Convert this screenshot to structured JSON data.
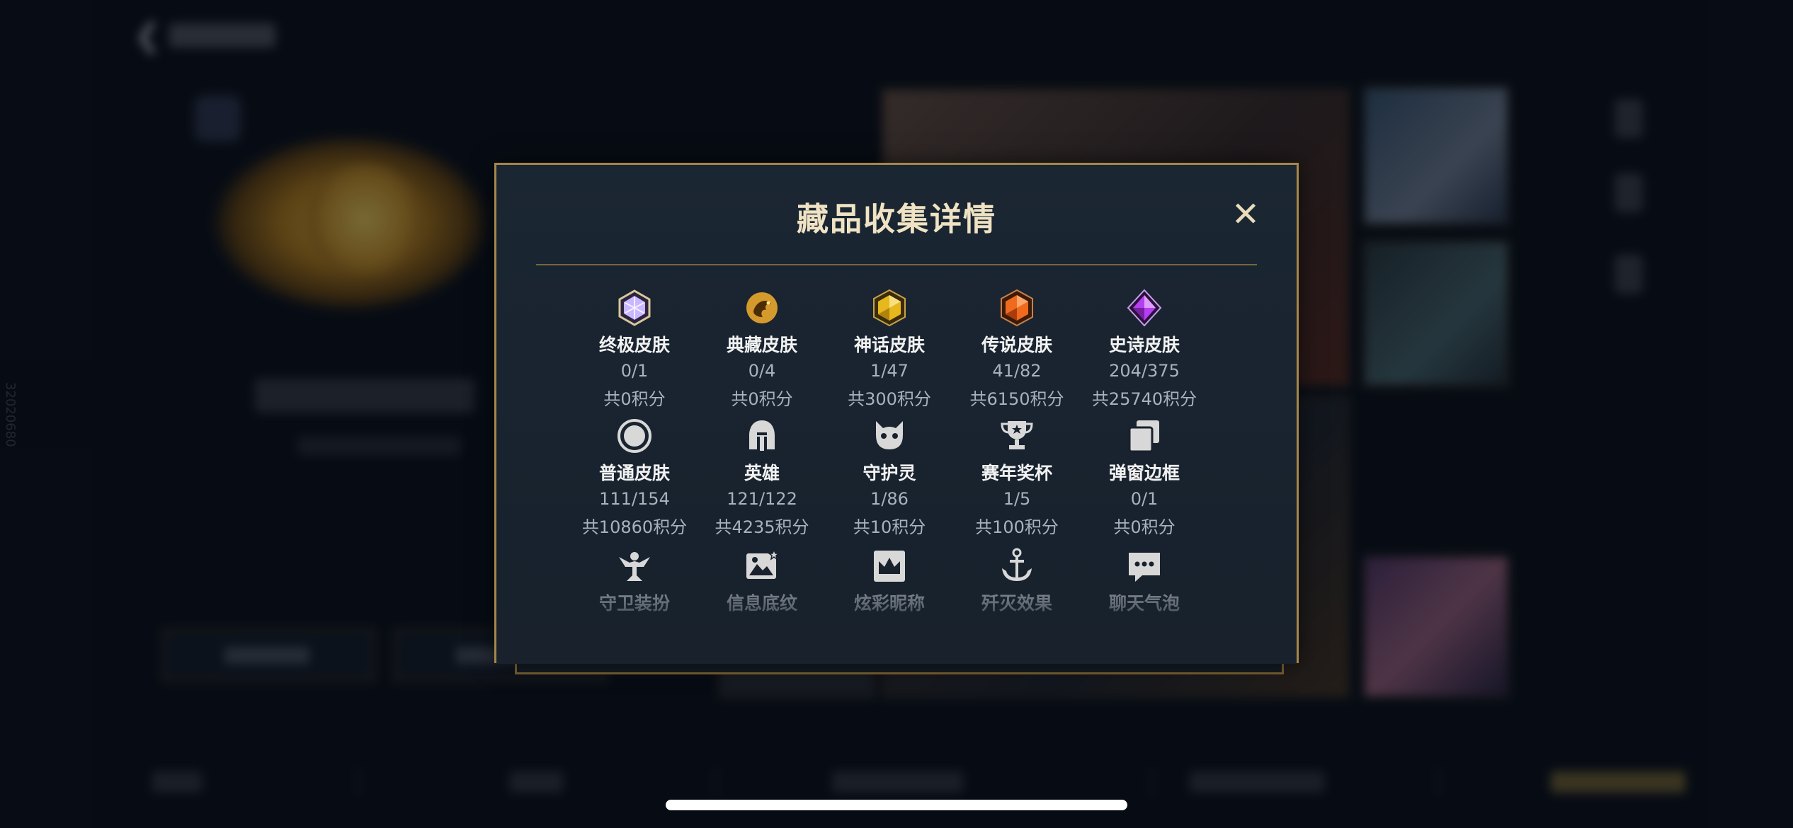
{
  "modal": {
    "title": "藏品收集详情",
    "close_glyph": "✕"
  },
  "collection": [
    {
      "name": "终极皮肤",
      "count": "0/1",
      "points": "共0积分",
      "icon": "ultimate-gem-icon",
      "color": "#c9b8ff"
    },
    {
      "name": "典藏皮肤",
      "count": "0/4",
      "points": "共0积分",
      "icon": "prestige-dragon-icon",
      "color": "#d59a2c"
    },
    {
      "name": "神话皮肤",
      "count": "1/47",
      "points": "共300积分",
      "icon": "mythic-gem-icon",
      "color": "#e6b81e"
    },
    {
      "name": "传说皮肤",
      "count": "41/82",
      "points": "共6150积分",
      "icon": "legendary-gem-icon",
      "color": "#f06a1e"
    },
    {
      "name": "史诗皮肤",
      "count": "204/375",
      "points": "共25740积分",
      "icon": "epic-gem-icon",
      "color": "#b43ef0"
    },
    {
      "name": "普通皮肤",
      "count": "111/154",
      "points": "共10860积分",
      "icon": "ring-icon",
      "color": "#d8d8d8"
    },
    {
      "name": "英雄",
      "count": "121/122",
      "points": "共4235积分",
      "icon": "helmet-icon",
      "color": "#d8d8d8"
    },
    {
      "name": "守护灵",
      "count": "1/86",
      "points": "共10积分",
      "icon": "little-legend-icon",
      "color": "#d8d8d8"
    },
    {
      "name": "赛年奖杯",
      "count": "1/5",
      "points": "共100积分",
      "icon": "trophy-icon",
      "color": "#d8d8d8"
    },
    {
      "name": "弹窗边框",
      "count": "0/1",
      "points": "共0积分",
      "icon": "frames-icon",
      "color": "#d8d8d8"
    },
    {
      "name": "守卫装扮",
      "icon": "ward-icon",
      "color": "#d8d8d8"
    },
    {
      "name": "信息底纹",
      "icon": "banner-icon",
      "color": "#d8d8d8"
    },
    {
      "name": "炫彩昵称",
      "icon": "crown-icon",
      "color": "#d8d8d8"
    },
    {
      "name": "歼灭效果",
      "icon": "anchor-icon",
      "color": "#d8d8d8"
    },
    {
      "name": "聊天气泡",
      "icon": "chat-bubble-icon",
      "color": "#d8d8d8"
    }
  ],
  "background": {
    "vertical_id": "32020680"
  },
  "colors": {
    "accent_gold": "#a6874a",
    "modal_bg": "#1b2633",
    "title_text": "#efe3c4"
  }
}
